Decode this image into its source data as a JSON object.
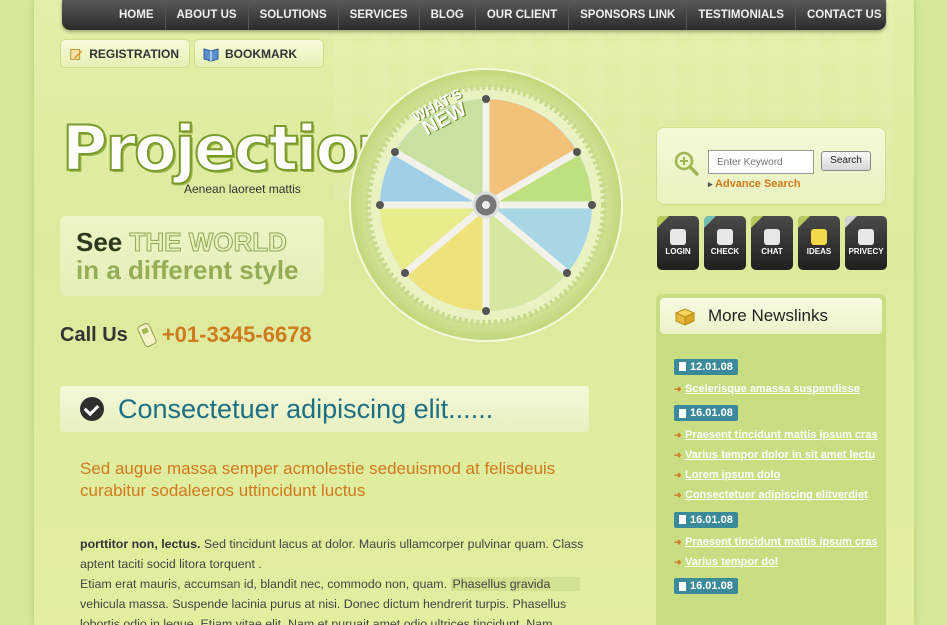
{
  "nav": [
    "HOME",
    "ABOUT US",
    "SOLUTIONS",
    "SERVICES",
    "BLOG",
    "OUR CLIENT",
    "SPONSORS LINK",
    "TESTIMONIALS",
    "CONTACT US"
  ],
  "top_buttons": {
    "registration": "REGISTRATION",
    "bookmark": "BOOKMARK"
  },
  "logo": {
    "title": "Projection",
    "tagline": "Aenean laoreet mattis"
  },
  "banner": {
    "see": "See",
    "world": "THE WORLD",
    "line2": "in a different style"
  },
  "call": {
    "label": "Call Us",
    "number": "+01-3345-6678"
  },
  "wheel": {
    "line1": "WHAT'S",
    "line2": "NEW"
  },
  "search": {
    "placeholder": "Enter Keyword",
    "button": "Search",
    "advanced": "Advance Search"
  },
  "icons": [
    {
      "label": "LOGIN",
      "name": "login-icon",
      "color": "#b9c95e"
    },
    {
      "label": "CHECK",
      "name": "check-icon",
      "color": "#6fc0b0"
    },
    {
      "label": "CHAT",
      "name": "chat-icon",
      "color": "#b9c95e"
    },
    {
      "label": "IDEAS",
      "name": "ideas-icon",
      "color": "#b9c95e"
    },
    {
      "label": "PRIVECY",
      "name": "privacy-icon",
      "color": "#d2d2d2"
    }
  ],
  "news": {
    "title": "More Newslinks",
    "groups": [
      {
        "date": "12.01.08",
        "links": [
          "Scelerisque amassa suspendisse"
        ]
      },
      {
        "date": "16.01.08",
        "links": [
          "Praesent tincidunt mattis ipsum cras",
          "Varius tempor dolor in sit amet lectu",
          "Lorem ipsum dolo",
          "Consectetuer adipiscing elitverdiet"
        ]
      },
      {
        "date": "16.01.08",
        "links": [
          "Praesent tincidunt mattis ipsum cras",
          "Varius tempor dol"
        ]
      },
      {
        "date": "16.01.08",
        "links": []
      }
    ]
  },
  "main": {
    "heading": "Consectetuer adipiscing elit......",
    "subheading": "Sed augue massa semper acmolestie sedeuismod at felisdeuis curabitur sodaleeros uttincidunt luctus",
    "para_bold": "porttitor non, lectus.",
    "para1": " Sed tincidunt lacus at dolor. Mauris ullamcorper pulvinar quam. Class aptent taciti socid litora torquent .",
    "para2_a": "Etiam erat mauris, accumsan id, blandit nec, commodo non, quam.",
    "para2_hl": "Phasellus gravida",
    "para2_b": "vehicula massa. Suspende lacinia purus at nisi. Donec dictum hendrerit turpis. Phasellus lobortis odio in leque. Etiam vitae elit. Nam et puruait amet odio ultrices tincidunt. Nam"
  }
}
